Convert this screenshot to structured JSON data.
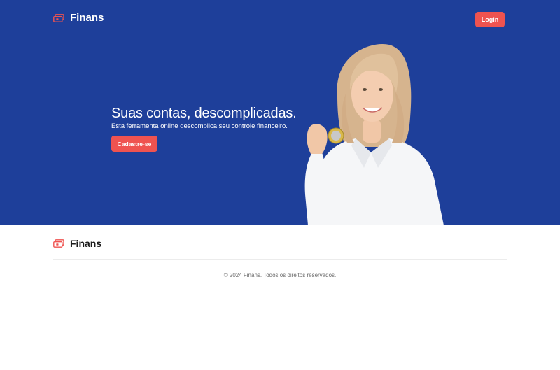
{
  "header": {
    "brand_name": "Finans",
    "login_label": "Login"
  },
  "hero": {
    "headline": "Suas contas, descomplicadas.",
    "subtitle": "Esta ferramenta online descomplica seu controle financeiro.",
    "cta_label": "Cadastre-se"
  },
  "footer": {
    "brand_name": "Finans",
    "copyright": "© 2024 Finans. Todos os direitos reservados."
  },
  "colors": {
    "hero_background": "#1e3f9a",
    "accent": "#ef5350",
    "footer_background": "#ffffff"
  },
  "icons": {
    "brand_logo": "wallet-icon"
  }
}
